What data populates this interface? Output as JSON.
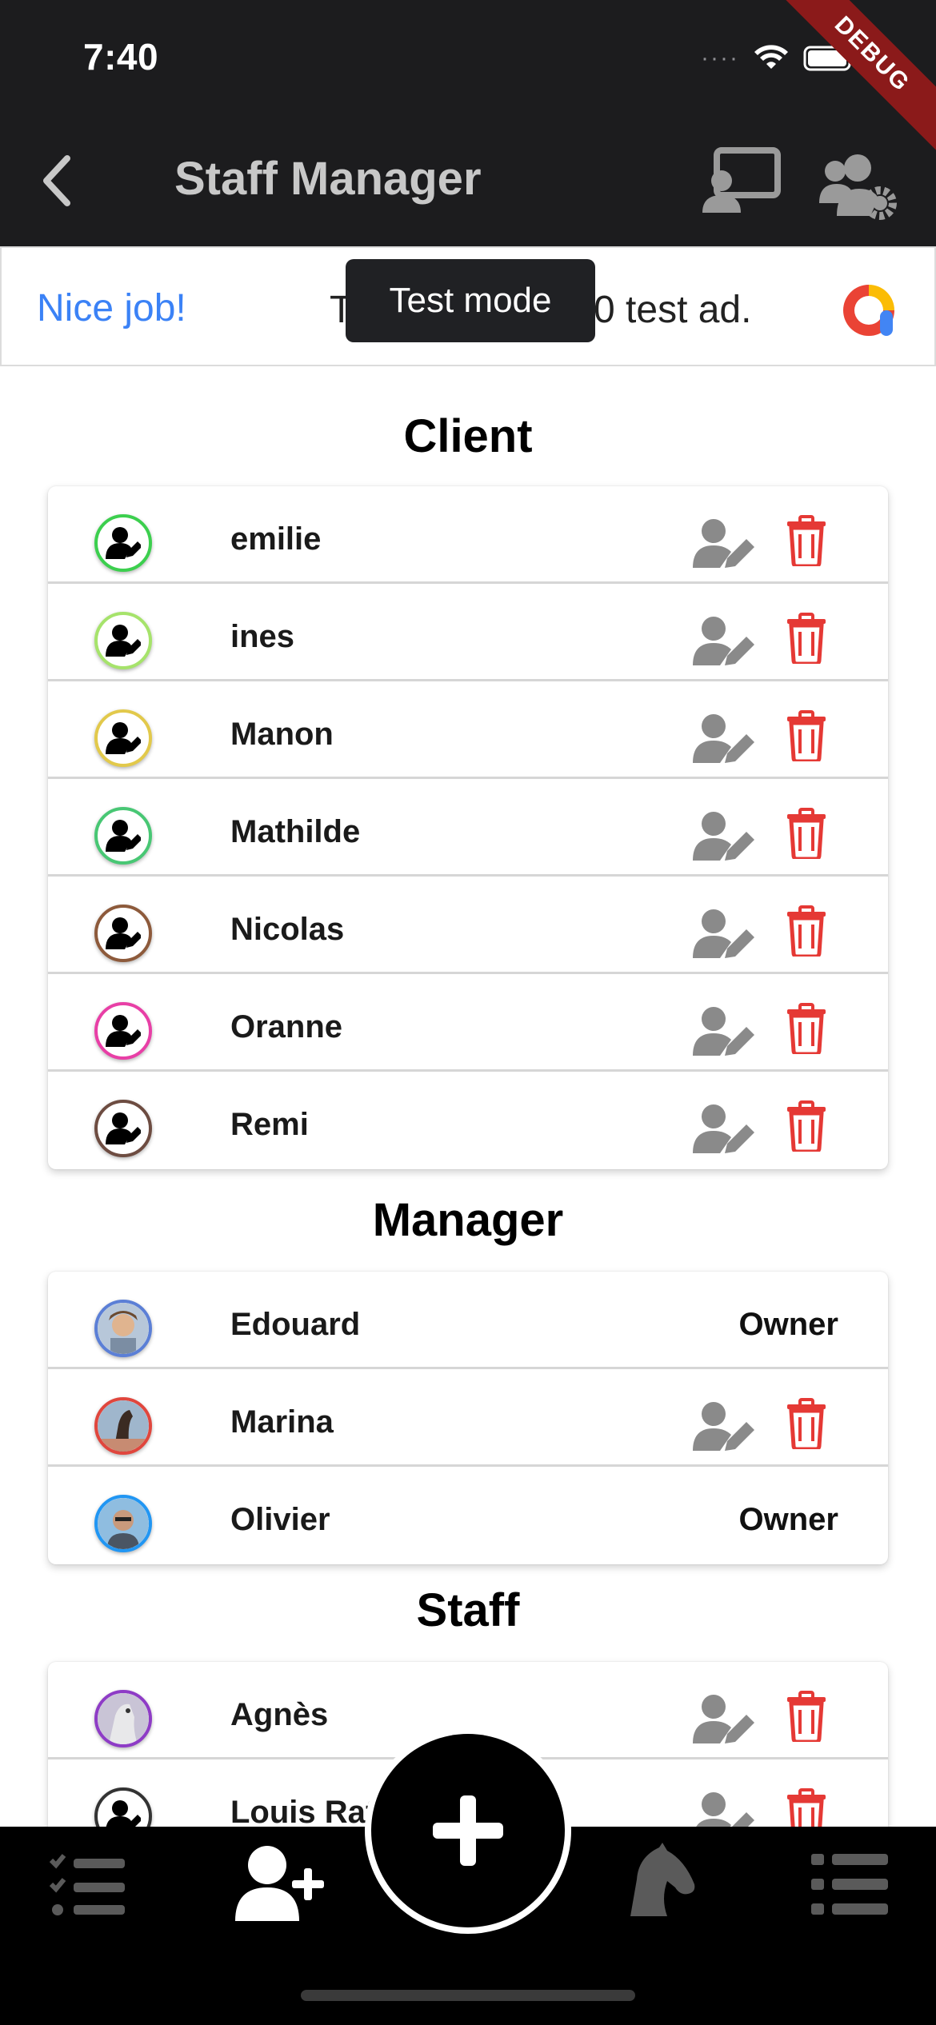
{
  "status_bar": {
    "time": "7:40",
    "debug_label": "DEBUG"
  },
  "app_bar": {
    "title": "Staff Manager"
  },
  "ad_banner": {
    "left_text": "Nice job!",
    "center_text_left": "T",
    "center_text_right": "0 test ad.",
    "tooltip": "Test mode"
  },
  "sections": {
    "client": {
      "title": "Client",
      "rows": [
        {
          "name": "emilie",
          "ring": "#3ccf4e"
        },
        {
          "name": "ines",
          "ring": "#a6e36b"
        },
        {
          "name": "Manon",
          "ring": "#e2c94b"
        },
        {
          "name": "Mathilde",
          "ring": "#48c774"
        },
        {
          "name": "Nicolas",
          "ring": "#8d5a3b"
        },
        {
          "name": "Oranne",
          "ring": "#e83fa6"
        },
        {
          "name": "Remi",
          "ring": "#6d4c41"
        }
      ]
    },
    "manager": {
      "title": "Manager",
      "rows": [
        {
          "name": "Edouard",
          "role": "Owner",
          "ring": "#5b7fd6"
        },
        {
          "name": "Marina",
          "ring": "#e0463d"
        },
        {
          "name": "Olivier",
          "role": "Owner",
          "ring": "#2196f3"
        }
      ]
    },
    "staff": {
      "title": "Staff",
      "rows": [
        {
          "name": "Agnès",
          "ring": "#8e3cc6"
        },
        {
          "name": "Louis Raf",
          "ring": "#333333"
        }
      ]
    }
  },
  "colors": {
    "delete_red": "#e53935",
    "edit_gray": "#8a8a8a",
    "link_blue": "#3b82f6"
  },
  "icons": {
    "back": "chevron-left-icon",
    "cast": "cast-icon",
    "settings": "users-gear-icon",
    "edit": "user-edit-icon",
    "delete": "trash-icon",
    "add": "plus-icon",
    "nav": [
      "task-list-icon",
      "user-plus-icon",
      "horse-head-icon",
      "list-icon"
    ]
  }
}
